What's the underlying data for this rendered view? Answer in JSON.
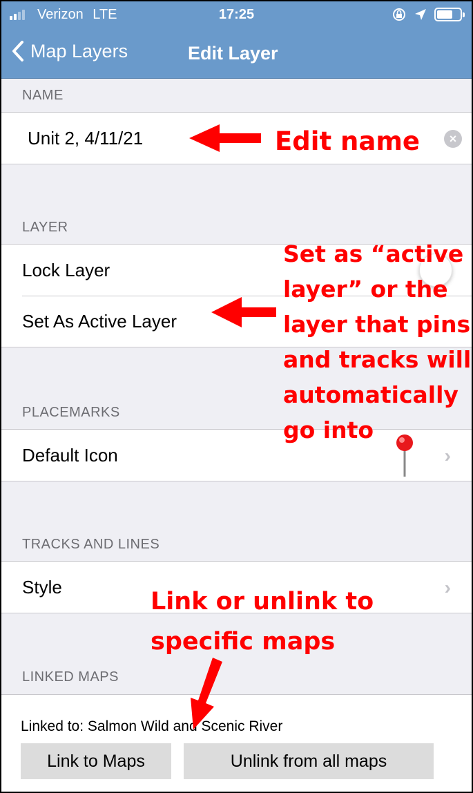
{
  "status_bar": {
    "carrier": "Verizon",
    "network": "LTE",
    "time": "17:25",
    "icons": [
      "signal-icon",
      "orientation-lock-icon",
      "location-arrow-icon",
      "battery-icon"
    ]
  },
  "nav": {
    "back_label": "Map Layers",
    "title": "Edit Layer"
  },
  "name_section": {
    "header": "NAME",
    "value": "Unit 2, 4/11/21"
  },
  "layer_section": {
    "header": "LAYER",
    "lock_label": "Lock Layer",
    "active_label": "Set As Active Layer"
  },
  "placemarks_section": {
    "header": "PLACEMARKS",
    "default_icon_label": "Default Icon"
  },
  "tracks_section": {
    "header": "TRACKS AND LINES",
    "style_label": "Style"
  },
  "linked_section": {
    "header": "LINKED MAPS",
    "linked_text": "Linked to: Salmon Wild and Scenic River",
    "link_button": "Link to Maps",
    "unlink_button": "Unlink from all maps"
  },
  "annotations": {
    "edit_name": "Edit name",
    "active_line1": "Set as “active",
    "active_line2": "layer” or the",
    "active_line3": "layer that pins",
    "active_line4": "and tracks will",
    "active_line5": "automatically",
    "active_line6": "go into",
    "link_line1": "Link or unlink to",
    "link_line2": "specific maps"
  },
  "colors": {
    "nav_bar": "#6a9acb",
    "annotation": "#ff0000",
    "background": "#efeff4"
  }
}
